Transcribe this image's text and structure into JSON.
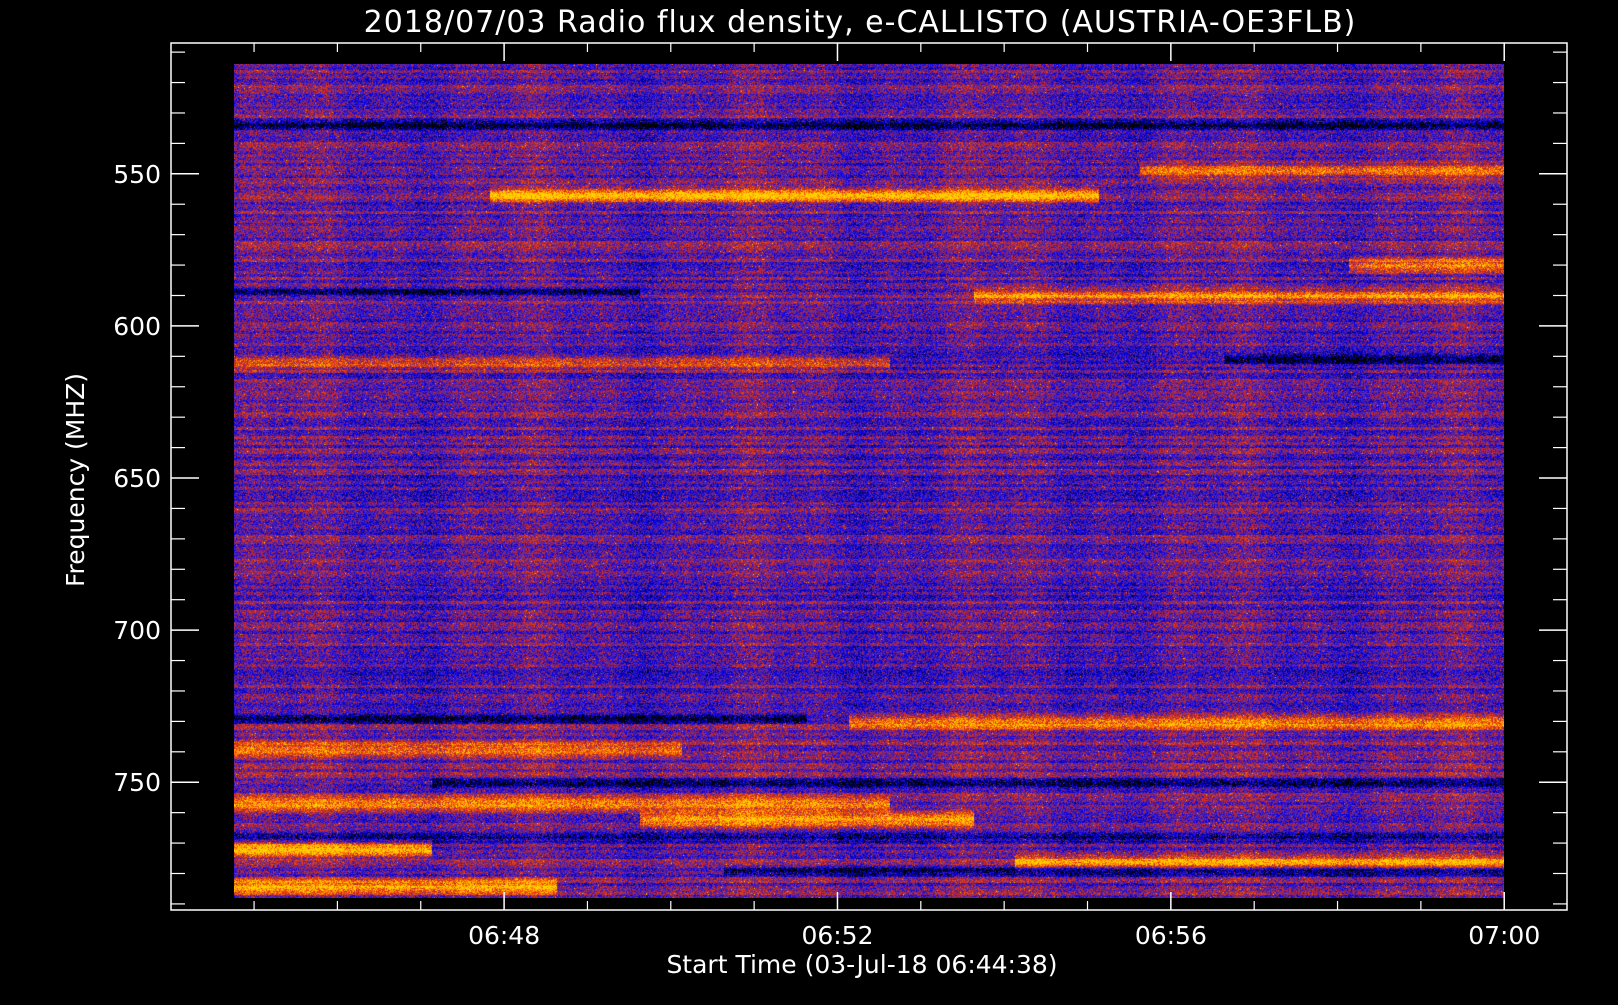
{
  "chart_data": {
    "type": "heatmap",
    "title": "2018/07/03  Radio flux density, e-CALLISTO (AUSTRIA-OE3FLB)",
    "xlabel": "Start Time (03-Jul-18 06:44:38)",
    "ylabel": "Frequency (MHZ)",
    "x_ticks": [
      "06:48",
      "06:52",
      "06:56",
      "07:00"
    ],
    "x_tick_minutes": [
      3.3667,
      7.3667,
      11.3667,
      15.3667
    ],
    "x_range_minutes": [
      -0.63,
      16.12
    ],
    "x_data_range_minutes": [
      0.13,
      15.37
    ],
    "x_minor_step_minutes": 1,
    "y_ticks": [
      550,
      600,
      650,
      700,
      750
    ],
    "ylim_mhz": [
      507,
      792
    ],
    "y_data_range_mhz": [
      514,
      788
    ],
    "y_minor_step_mhz": 10,
    "y_inverted": true,
    "grid": false,
    "colormap": [
      "#000000",
      "#0000ff",
      "#5a2896",
      "#d2281e",
      "#ff6a00",
      "#ffd200"
    ],
    "bright_bands_mhz": [
      {
        "freq": 557,
        "start_min": 3.2,
        "end_min": 10.5,
        "intensity": 0.75
      },
      {
        "freq": 549,
        "start_min": 11.0,
        "end_min": 15.37,
        "intensity": 0.5
      },
      {
        "freq": 590,
        "start_min": 9.0,
        "end_min": 15.37,
        "intensity": 0.55
      },
      {
        "freq": 580,
        "start_min": 13.5,
        "end_min": 15.37,
        "intensity": 0.6
      },
      {
        "freq": 612,
        "start_min": 0.13,
        "end_min": 8.0,
        "intensity": 0.45
      },
      {
        "freq": 730,
        "start_min": 7.5,
        "end_min": 15.37,
        "intensity": 0.6
      },
      {
        "freq": 739,
        "start_min": 0.13,
        "end_min": 5.5,
        "intensity": 0.5
      },
      {
        "freq": 757,
        "start_min": 0.13,
        "end_min": 8.0,
        "intensity": 0.6
      },
      {
        "freq": 762,
        "start_min": 5.0,
        "end_min": 9.0,
        "intensity": 0.75
      },
      {
        "freq": 772,
        "start_min": 0.13,
        "end_min": 2.5,
        "intensity": 0.85
      },
      {
        "freq": 776,
        "start_min": 9.5,
        "end_min": 15.37,
        "intensity": 0.6
      },
      {
        "freq": 784,
        "start_min": 0.13,
        "end_min": 4.0,
        "intensity": 0.7
      }
    ],
    "dark_bands_mhz": [
      {
        "freq": 534,
        "start_min": 0.13,
        "end_min": 15.37
      },
      {
        "freq": 589,
        "start_min": 0.13,
        "end_min": 5.0
      },
      {
        "freq": 611,
        "start_min": 12.0,
        "end_min": 15.37
      },
      {
        "freq": 729,
        "start_min": 0.13,
        "end_min": 7.0
      },
      {
        "freq": 750,
        "start_min": 2.5,
        "end_min": 15.37
      },
      {
        "freq": 768,
        "start_min": 0.13,
        "end_min": 15.37
      },
      {
        "freq": 779,
        "start_min": 6.0,
        "end_min": 15.37
      }
    ]
  }
}
